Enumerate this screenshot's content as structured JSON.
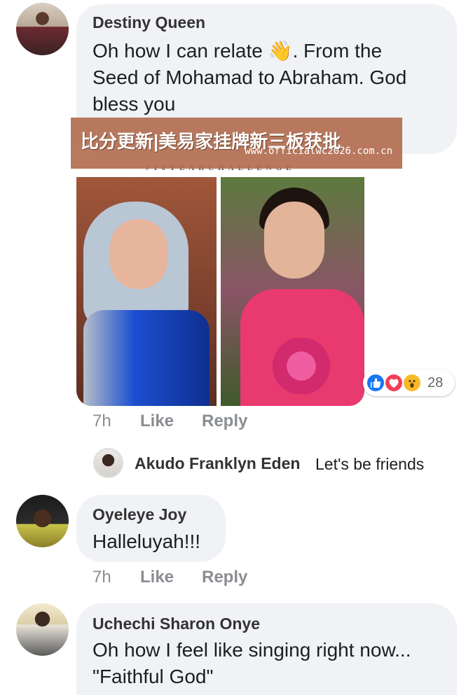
{
  "comments": [
    {
      "author": "Destiny Queen",
      "lines": [
        "Oh how I can relate 👋. From the",
        "Seed of Mohamad to Abraham. God",
        "bless you"
      ],
      "photo_hashtag": "#10YEARCHALLENGE",
      "reaction_icons": [
        "like-icon",
        "love-icon",
        "wow-icon"
      ],
      "reaction_count": "28",
      "time": "7h",
      "like_label": "Like",
      "reply_label": "Reply",
      "reply": {
        "author": "Akudo Franklyn Eden",
        "text": "Let's be friends"
      }
    },
    {
      "author": "Oyeleye Joy",
      "lines": [
        "Halleluyah!!!"
      ],
      "time": "7h",
      "like_label": "Like",
      "reply_label": "Reply"
    },
    {
      "author": "Uchechi Sharon Onye",
      "lines": [
        "Oh how I feel like singing right now...",
        "\"Faithful God\""
      ]
    }
  ],
  "watermark": {
    "title": "比分更新|美易家挂牌新三板获批",
    "url": "www.officialwc2026.com.cn"
  },
  "colors": {
    "bubble": "#f0f2f5",
    "meta_text": "#8a8d91",
    "like_blue": "#1877f2",
    "love_red": "#f33e58",
    "wow_yellow": "#f7b928",
    "watermark_bg": "#b26e50"
  }
}
